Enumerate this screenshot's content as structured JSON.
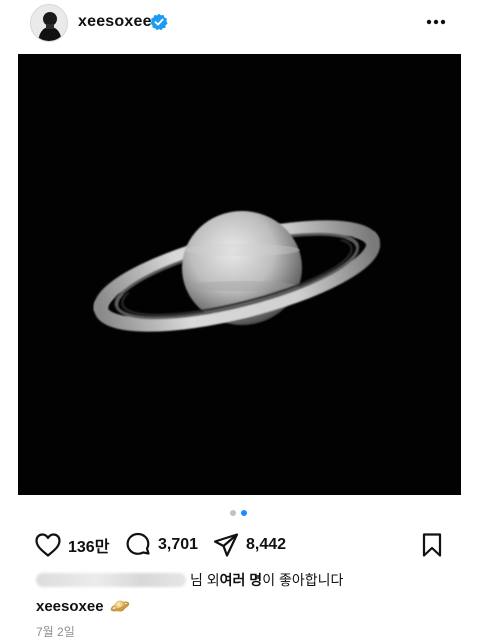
{
  "post": {
    "author": {
      "username": "xeesoxee",
      "verified": true
    },
    "image": {
      "subject": "saturn-photo"
    },
    "carousel": {
      "total": 2,
      "current": 2
    },
    "actions": {
      "likes": "136만",
      "comments": "3,701",
      "shares": "8,442"
    },
    "likes_summary": {
      "suffix_1": "님 외 ",
      "bold": "여러 명",
      "suffix_2": "이 좋아합니다"
    },
    "caption": {
      "username": "xeesoxee",
      "emoji": "saturn-emoji"
    },
    "date": "7월 2일"
  },
  "colors": {
    "accent": "#1a8cff",
    "verified": "#1d9bf0",
    "dot_inactive": "#bfc2c6",
    "muted_text": "#8e8e8e"
  },
  "icons": [
    "more-icon",
    "heart-icon",
    "comment-icon",
    "share-icon",
    "bookmark-icon",
    "verified-badge-icon"
  ]
}
